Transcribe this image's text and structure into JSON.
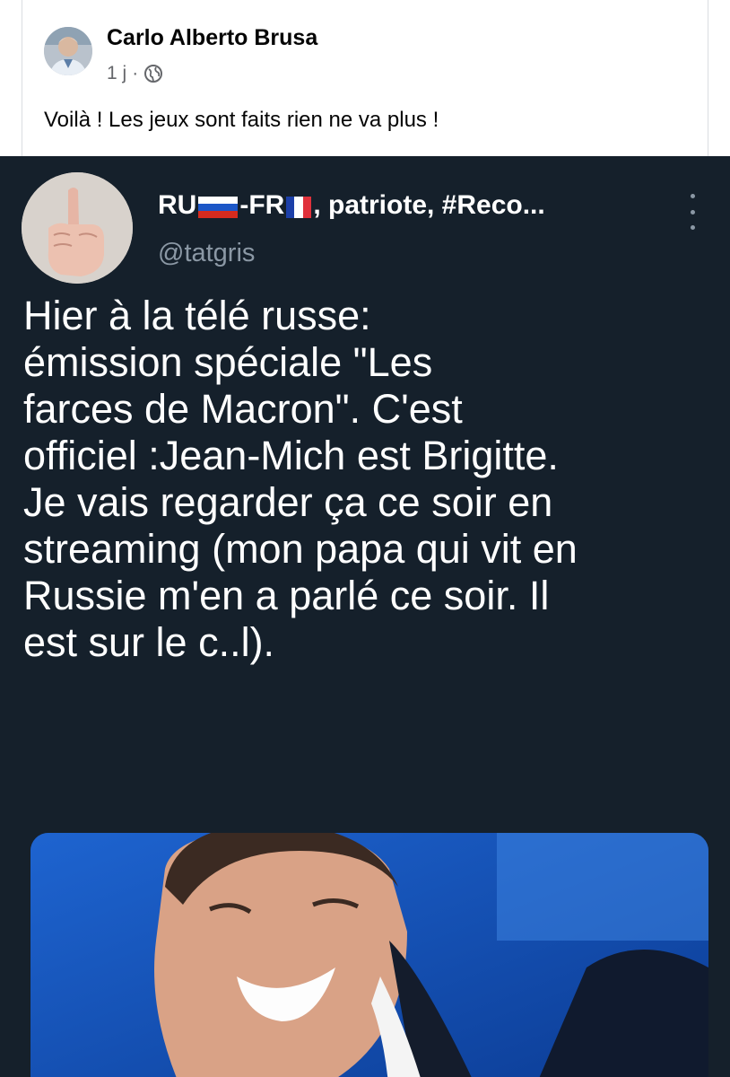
{
  "facebook_post": {
    "author": "Carlo Alberto Brusa",
    "time": "1 j",
    "separator": "·",
    "audience_icon": "globe-icon",
    "text": "Voilà ! Les jeux sont faits rien ne va plus !"
  },
  "tweet": {
    "name_prefix": "RU",
    "name_middle": "-FR",
    "name_suffix": ", patriote, #Reco...",
    "flags": [
      "russia-flag-icon",
      "france-flag-icon"
    ],
    "handle": "@tatgris",
    "more_icon": "more-vertical-icon",
    "body_lines": [
      "Hier à la télé russe:",
      "émission spéciale \"Les",
      "farces de Macron\". C'est",
      "officiel :Jean-Mich est Brigitte.",
      "Je vais regarder ça ce soir en",
      "streaming (mon papa qui vit en",
      "Russie m'en a parlé ce soir. Il",
      "est sur le c..l)."
    ]
  },
  "colors": {
    "tweet_background": "#15202b",
    "tweet_text": "#ffffff",
    "tweet_handle": "#8b98a5",
    "fb_meta": "#65676b"
  }
}
